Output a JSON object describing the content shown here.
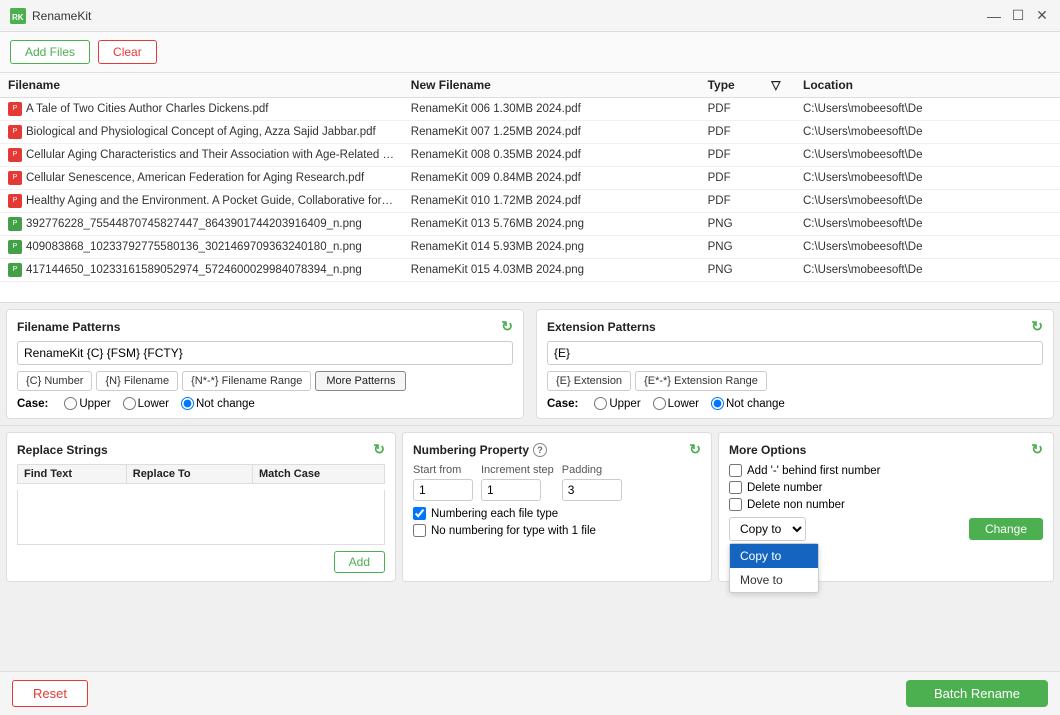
{
  "app": {
    "title": "RenameKit",
    "icon": "RK"
  },
  "titlebar": {
    "minimize": "—",
    "maximize": "☐",
    "close": "✕"
  },
  "toolbar": {
    "add_files": "Add Files",
    "clear": "Clear"
  },
  "table": {
    "columns": [
      "Filename",
      "New Filename",
      "Type",
      "",
      "Location"
    ],
    "rows": [
      {
        "icon": "pdf",
        "filename": "A Tale of Two Cities Author Charles Dickens.pdf",
        "new_filename": "RenameKit 006 1.30MB 2024.pdf",
        "type": "PDF",
        "location": "C:\\Users\\mobeesoft\\De"
      },
      {
        "icon": "pdf",
        "filename": "Biological and Physiological Concept of Aging, Azza Sajid Jabbar.pdf",
        "new_filename": "RenameKit 007 1.25MB 2024.pdf",
        "type": "PDF",
        "location": "C:\\Users\\mobeesoft\\De"
      },
      {
        "icon": "pdf",
        "filename": "Cellular Aging Characteristics and Their Association with Age-Related Disorder:",
        "new_filename": "RenameKit 008 0.35MB 2024.pdf",
        "type": "PDF",
        "location": "C:\\Users\\mobeesoft\\De"
      },
      {
        "icon": "pdf",
        "filename": "Cellular Senescence, American Federation for Aging Research.pdf",
        "new_filename": "RenameKit 009 0.84MB 2024.pdf",
        "type": "PDF",
        "location": "C:\\Users\\mobeesoft\\De"
      },
      {
        "icon": "pdf",
        "filename": "Healthy Aging and the Environment. A Pocket Guide, Collaborative for Health &",
        "new_filename": "RenameKit 010 1.72MB 2024.pdf",
        "type": "PDF",
        "location": "C:\\Users\\mobeesoft\\De"
      },
      {
        "icon": "png",
        "filename": "392776228_75544870745827447_8643901744203916409_n.png",
        "new_filename": "RenameKit 013 5.76MB 2024.png",
        "type": "PNG",
        "location": "C:\\Users\\mobeesoft\\De"
      },
      {
        "icon": "png",
        "filename": "409083868_10233792775580136_3021469709363240180_n.png",
        "new_filename": "RenameKit 014 5.93MB 2024.png",
        "type": "PNG",
        "location": "C:\\Users\\mobeesoft\\De"
      },
      {
        "icon": "png",
        "filename": "417144650_10233161589052974_5724600029984078394_n.png",
        "new_filename": "RenameKit 015 4.03MB 2024.png",
        "type": "PNG",
        "location": "C:\\Users\\mobeesoft\\De"
      }
    ]
  },
  "filename_patterns": {
    "title": "Filename Patterns",
    "value": "RenameKit {C} {FSM} {FCTY}",
    "buttons": [
      "{C} Number",
      "{N} Filename",
      "{N*-*} Filename Range",
      "More Patterns"
    ],
    "case_label": "Case:",
    "case_options": [
      "Upper",
      "Lower",
      "Not change"
    ],
    "case_selected": "Not change"
  },
  "extension_patterns": {
    "title": "Extension Patterns",
    "value": "{E}",
    "buttons": [
      "{E} Extension",
      "{E*-*} Extension Range"
    ],
    "case_label": "Case:",
    "case_options": [
      "Upper",
      "Lower",
      "Not change"
    ],
    "case_selected": "Not change"
  },
  "replace_strings": {
    "title": "Replace Strings",
    "columns": [
      "Find Text",
      "Replace To",
      "Match Case"
    ],
    "add_label": "Add"
  },
  "numbering_property": {
    "title": "Numbering Property",
    "start_from_label": "Start from",
    "start_from_value": "1",
    "increment_step_label": "Increment step",
    "increment_step_value": "1",
    "padding_label": "Padding",
    "padding_value": "3",
    "numbering_each": "Numbering each file type",
    "no_numbering": "No numbering for type with 1 file"
  },
  "more_options": {
    "title": "More Options",
    "add_dash": "Add '-' behind first number",
    "delete_number": "Delete number",
    "delete_non_number": "Delete non number",
    "copy_to_label": "Copy to",
    "copy_to_options": [
      "Copy to",
      "Move to"
    ],
    "copy_to_selected": "Copy to",
    "change_label": "Change",
    "dropdown_items": [
      "Copy to",
      "Move to"
    ]
  },
  "footer": {
    "reset_label": "Reset",
    "batch_rename_label": "Batch Rename"
  }
}
